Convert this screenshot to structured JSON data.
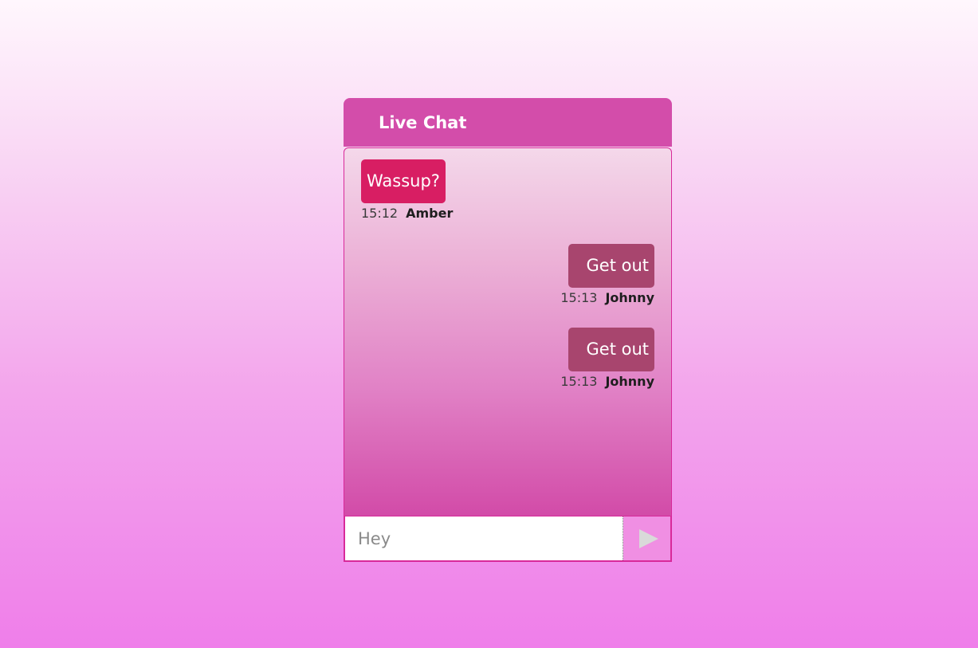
{
  "header": {
    "title": "Live Chat"
  },
  "messages": [
    {
      "text": "Wassup?",
      "time": "15:12",
      "user": "Amber",
      "side": "left"
    },
    {
      "text": "Get out",
      "time": "15:13",
      "user": "Johnny",
      "side": "right"
    },
    {
      "text": "Get out",
      "time": "15:13",
      "user": "Johnny",
      "side": "right"
    }
  ],
  "composer": {
    "value": "",
    "placeholder": "Hey",
    "send_icon": "play-triangle"
  },
  "colors": {
    "header_bg": "#d34daa",
    "amber_bubble": "#d81e63",
    "johnny_bubble": "#a8456e",
    "border_accent": "#d8299a"
  }
}
